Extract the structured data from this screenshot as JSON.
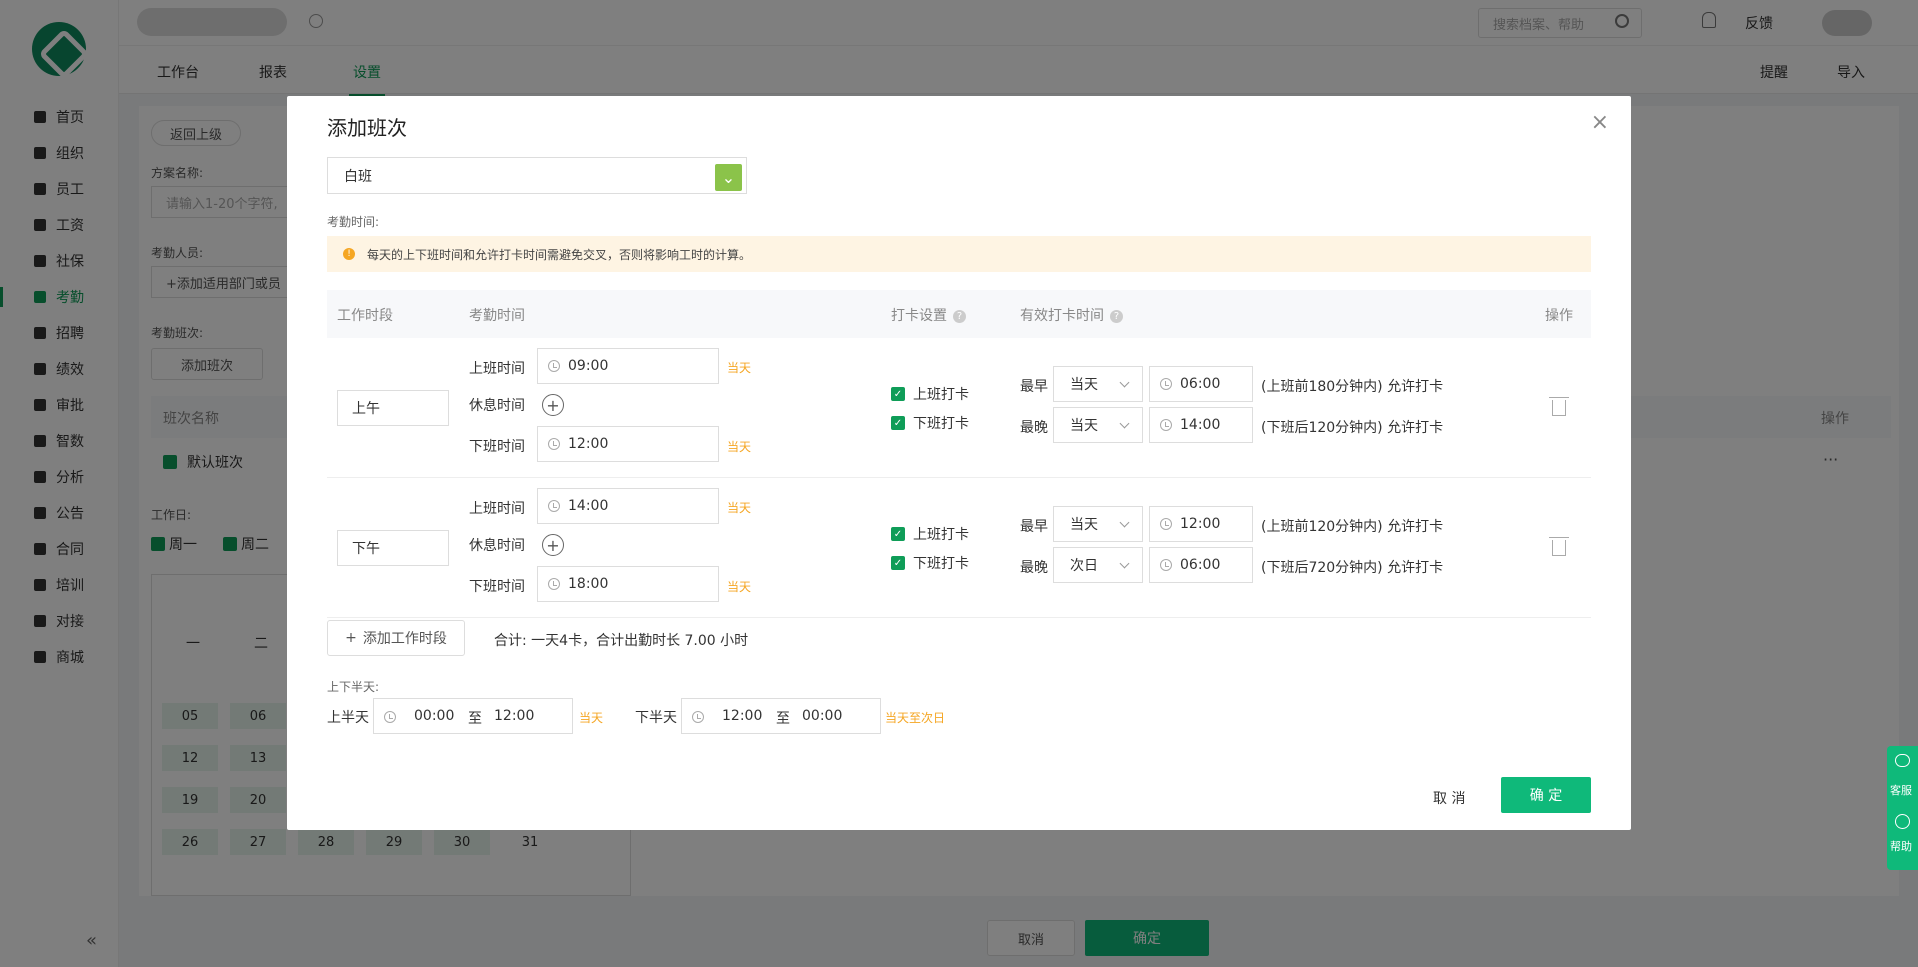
{
  "nav": {
    "items": [
      "首页",
      "组织",
      "员工",
      "工资",
      "社保",
      "考勤",
      "招聘",
      "绩效",
      "审批",
      "智数",
      "分析",
      "公告",
      "合同",
      "培训",
      "对接",
      "商城"
    ],
    "active_index": 5,
    "collapse_icon": "«"
  },
  "topbar": {
    "search_placeholder": "搜索档案、帮助",
    "feedback": "反馈"
  },
  "tabs": [
    "工作台",
    "报表",
    "设置"
  ],
  "tabs_active_index": 2,
  "tab_actions": {
    "remind": "提醒",
    "import": "导入"
  },
  "page": {
    "back": "返回上级",
    "scheme_name_label": "方案名称:",
    "scheme_name_placeholder": "请输入1-20个字符,",
    "attendee_label": "考勤人员:",
    "attendee_button": "+添加适用部门或员",
    "shift_label": "考勤班次:",
    "add_shift_button": "添加班次",
    "table_header_name": "班次名称",
    "table_header_ops": "操作",
    "default_shift": "默认班次",
    "ops_more": "···",
    "workdays_label": "工作日:",
    "workdays": [
      "周一",
      "周二"
    ],
    "calendar_weekdays": [
      "一",
      "二"
    ],
    "calendar_rows": [
      [
        "05",
        "06"
      ],
      [
        "12",
        "13"
      ],
      [
        "19",
        "20"
      ],
      [
        "26",
        "27",
        "28",
        "29",
        "30",
        "31"
      ]
    ],
    "cancel": "取消",
    "confirm": "确定"
  },
  "modal": {
    "title": "添加班次",
    "close_icon": "×",
    "shift_type": "白班",
    "attendance_time_label": "考勤时间:",
    "notice": "每天的上下班时间和允许打卡时间需避免交叉，否则将影响工时的计算。",
    "headers": {
      "period": "工作时段",
      "time": "考勤时间",
      "punch": "打卡设置",
      "valid": "有效打卡时间",
      "ops": "操作"
    },
    "labels": {
      "on": "上班时间",
      "rest": "休息时间",
      "off": "下班时间",
      "today": "当天",
      "on_punch": "上班打卡",
      "off_punch": "下班打卡",
      "earliest": "最早",
      "latest": "最晚"
    },
    "segments": [
      {
        "name": "上午",
        "on": "09:00",
        "off": "12:00",
        "earliest_day": "当天",
        "earliest_time": "06:00",
        "earliest_note": "(上班前180分钟内) 允许打卡",
        "latest_day": "当天",
        "latest_time": "14:00",
        "latest_note": "(下班后120分钟内) 允许打卡"
      },
      {
        "name": "下午",
        "on": "14:00",
        "off": "18:00",
        "earliest_day": "当天",
        "earliest_time": "12:00",
        "earliest_note": "(上班前120分钟内) 允许打卡",
        "latest_day": "次日",
        "latest_time": "06:00",
        "latest_note": "(下班后720分钟内) 允许打卡"
      }
    ],
    "add_segment": "添加工作时段",
    "summary": "合计: 一天4卡，合计出勤时长 7.00 小时",
    "half_day_label": "上下半天:",
    "first_half": {
      "label": "上半天",
      "from": "00:00",
      "to_word": "至",
      "to": "12:00",
      "suffix": "当天"
    },
    "second_half": {
      "label": "下半天",
      "from": "12:00",
      "to_word": "至",
      "to": "00:00",
      "suffix": "当天至次日"
    },
    "cancel": "取 消",
    "confirm": "确 定"
  },
  "float": {
    "service": "客服",
    "help": "帮助"
  },
  "colors": {
    "brand": "#0fb97a",
    "accent_orange": "#f5a623",
    "notice_bg": "#fef4e3"
  }
}
